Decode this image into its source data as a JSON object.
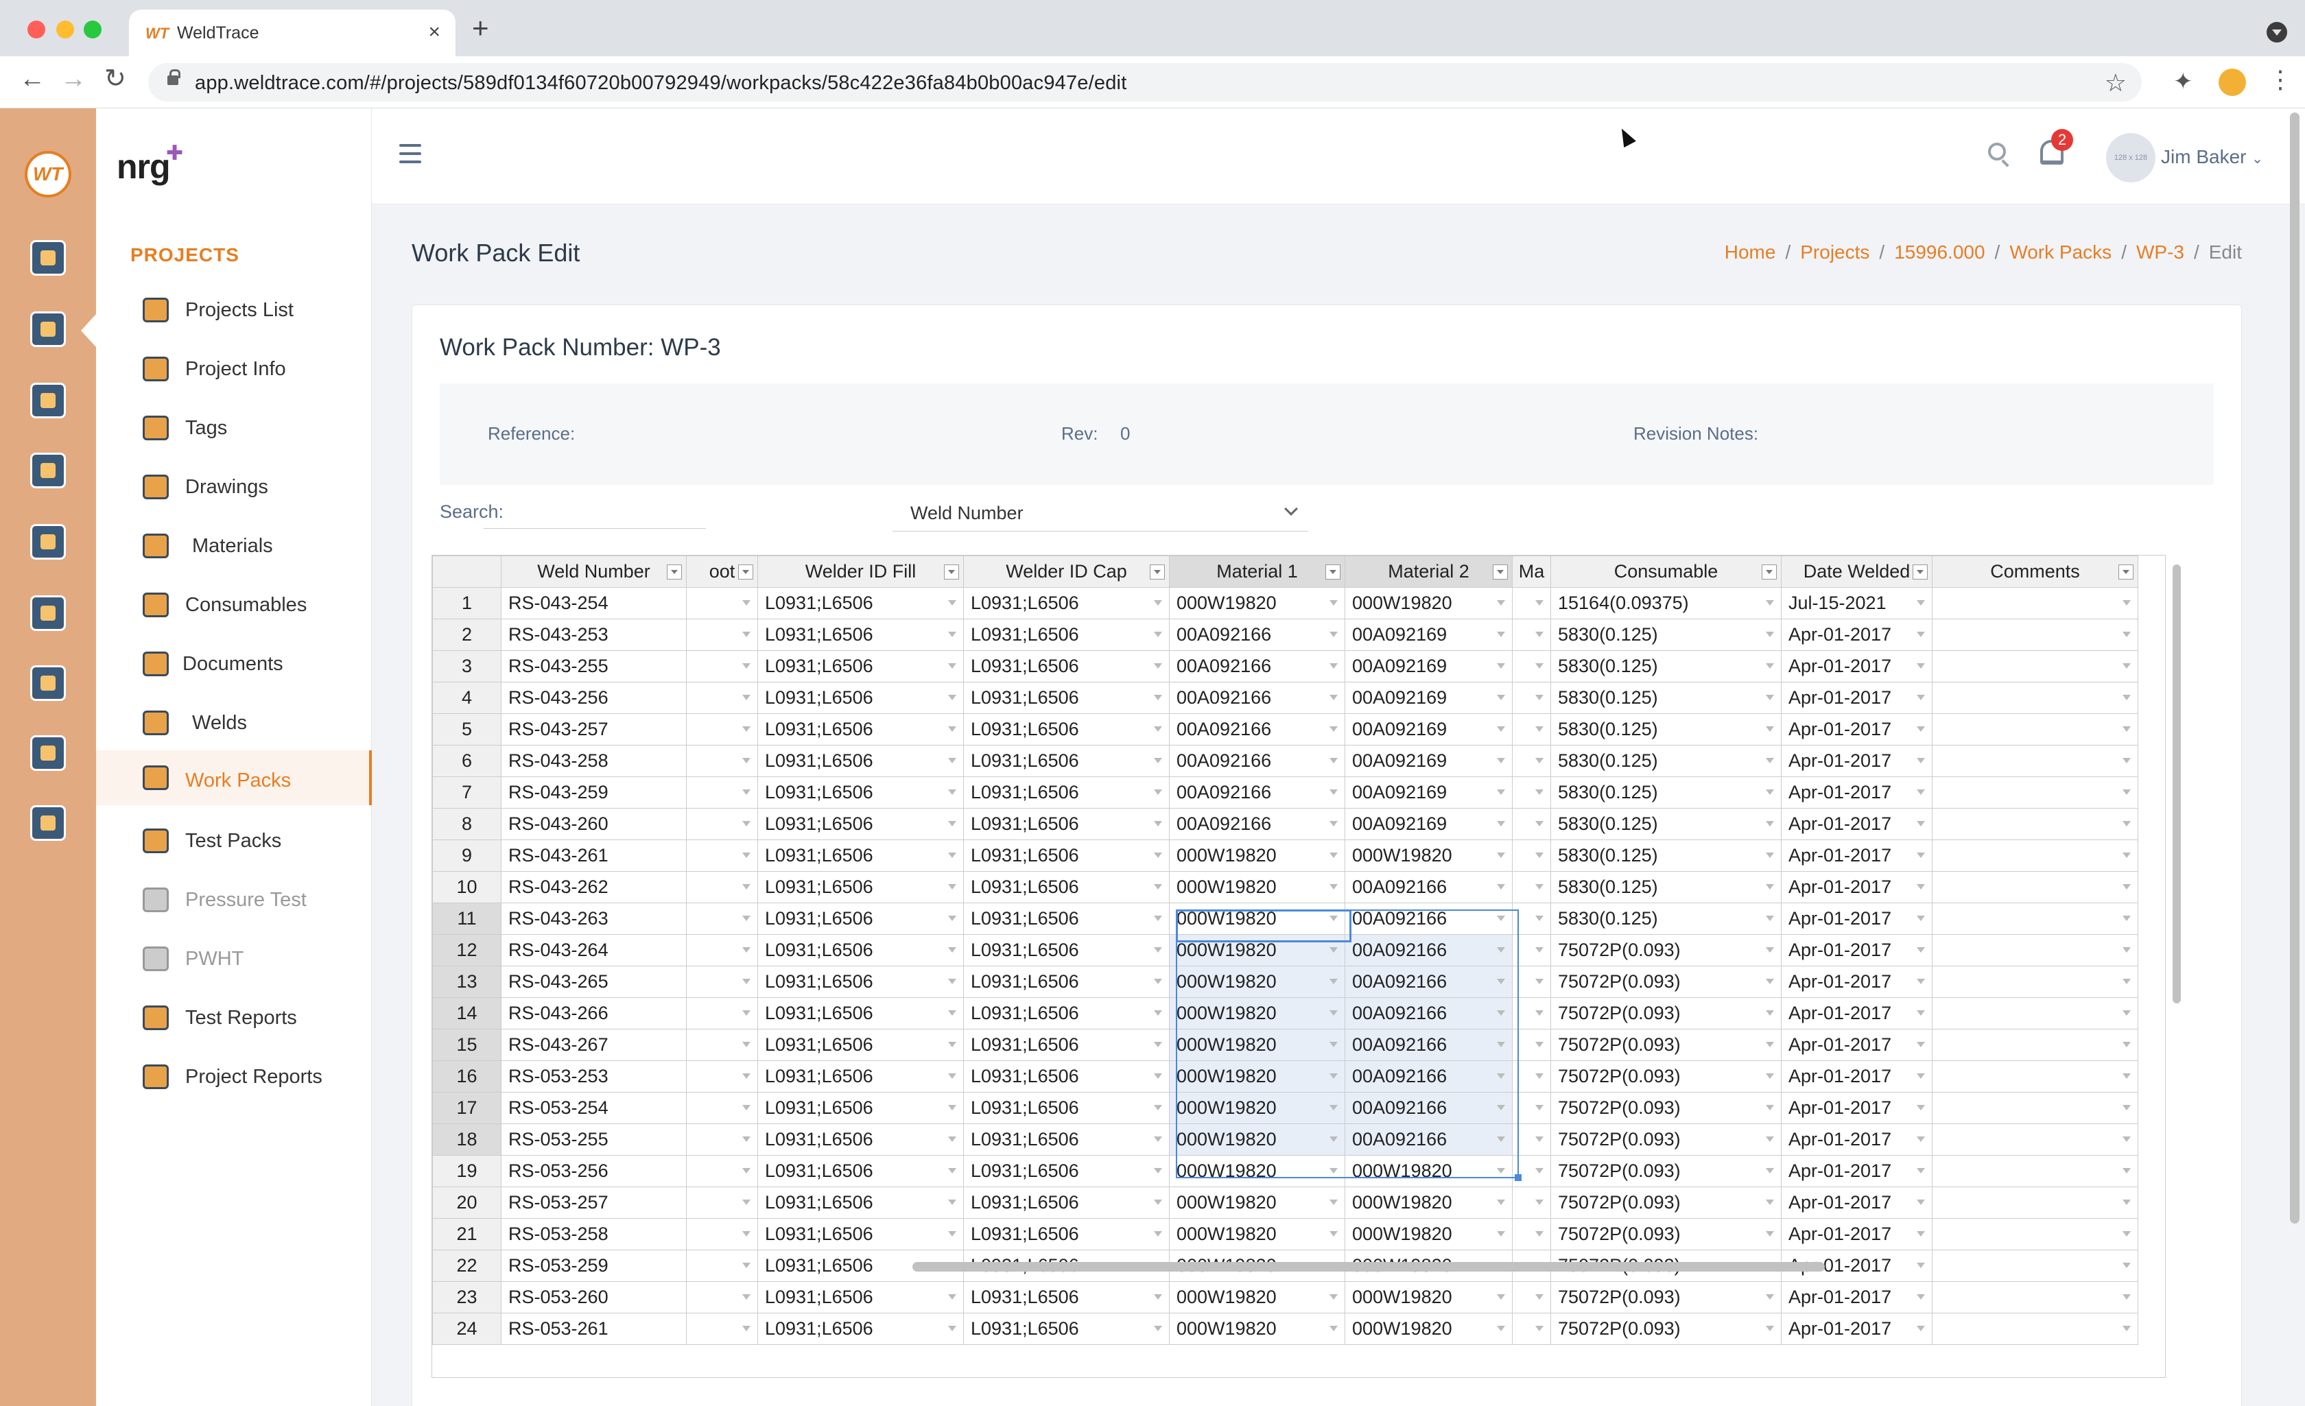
{
  "browser": {
    "tab_favicon": "WT",
    "tab_title": "WeldTrace",
    "url": "app.weldtrace.com/#/projects/589df0134f60720b00792949/workpacks/58c422e36fa84b0b00ac947e/edit"
  },
  "app": {
    "brand": "nrg",
    "rail_logo": "WT",
    "section_title": "PROJECTS",
    "nav": [
      {
        "label": "Projects List",
        "icon": "projects-list-icon"
      },
      {
        "label": "Project Info",
        "icon": "project-info-icon"
      },
      {
        "label": "Tags",
        "icon": "tag-icon"
      },
      {
        "label": "Drawings",
        "icon": "drawings-icon"
      },
      {
        "label": "Materials",
        "icon": "materials-icon"
      },
      {
        "label": "Consumables",
        "icon": "consumables-icon"
      },
      {
        "label": "Documents",
        "icon": "documents-icon"
      },
      {
        "label": "Welds",
        "icon": "welds-icon"
      },
      {
        "label": "Work Packs",
        "icon": "work-packs-icon",
        "active": true
      },
      {
        "label": "Test Packs",
        "icon": "test-packs-icon"
      },
      {
        "label": "Pressure Test",
        "icon": "pressure-test-icon",
        "disabled": true
      },
      {
        "label": "PWHT",
        "icon": "pwht-icon",
        "disabled": true
      },
      {
        "label": "Test Reports",
        "icon": "test-reports-icon"
      },
      {
        "label": "Project Reports",
        "icon": "project-reports-icon"
      }
    ],
    "notifications_count": "2",
    "user_avatar_text": "128 x 128",
    "user_name": "Jim Baker"
  },
  "page": {
    "title": "Work Pack Edit",
    "breadcrumb": [
      "Home",
      "Projects",
      "15996.000",
      "Work Packs",
      "WP-3",
      "Edit"
    ],
    "card_title": "Work Pack Number: WP-3",
    "reference_label": "Reference:",
    "rev_label": "Rev:",
    "rev_value": "0",
    "revision_notes_label": "Revision Notes:",
    "search_label": "Search:",
    "search_field": "Weld Number"
  },
  "grid": {
    "columns": [
      "Weld Number",
      "oot",
      "Welder ID Fill",
      "Welder ID Cap",
      "Material 1",
      "Material 2",
      "Ma",
      "Consumable",
      "Date Welded",
      "Comments"
    ],
    "rows": [
      [
        "1",
        "RS-043-254",
        "",
        "L0931;L6506",
        "L0931;L6506",
        "000W19820",
        "000W19820",
        "",
        "15164(0.09375)",
        "Jul-15-2021",
        ""
      ],
      [
        "2",
        "RS-043-253",
        "",
        "L0931;L6506",
        "L0931;L6506",
        "00A092166",
        "00A092169",
        "",
        "5830(0.125)",
        "Apr-01-2017",
        ""
      ],
      [
        "3",
        "RS-043-255",
        "",
        "L0931;L6506",
        "L0931;L6506",
        "00A092166",
        "00A092169",
        "",
        "5830(0.125)",
        "Apr-01-2017",
        ""
      ],
      [
        "4",
        "RS-043-256",
        "",
        "L0931;L6506",
        "L0931;L6506",
        "00A092166",
        "00A092169",
        "",
        "5830(0.125)",
        "Apr-01-2017",
        ""
      ],
      [
        "5",
        "RS-043-257",
        "",
        "L0931;L6506",
        "L0931;L6506",
        "00A092166",
        "00A092169",
        "",
        "5830(0.125)",
        "Apr-01-2017",
        ""
      ],
      [
        "6",
        "RS-043-258",
        "",
        "L0931;L6506",
        "L0931;L6506",
        "00A092166",
        "00A092169",
        "",
        "5830(0.125)",
        "Apr-01-2017",
        ""
      ],
      [
        "7",
        "RS-043-259",
        "",
        "L0931;L6506",
        "L0931;L6506",
        "00A092166",
        "00A092169",
        "",
        "5830(0.125)",
        "Apr-01-2017",
        ""
      ],
      [
        "8",
        "RS-043-260",
        "",
        "L0931;L6506",
        "L0931;L6506",
        "00A092166",
        "00A092169",
        "",
        "5830(0.125)",
        "Apr-01-2017",
        ""
      ],
      [
        "9",
        "RS-043-261",
        "",
        "L0931;L6506",
        "L0931;L6506",
        "000W19820",
        "000W19820",
        "",
        "5830(0.125)",
        "Apr-01-2017",
        ""
      ],
      [
        "10",
        "RS-043-262",
        "",
        "L0931;L6506",
        "L0931;L6506",
        "000W19820",
        "00A092166",
        "",
        "5830(0.125)",
        "Apr-01-2017",
        ""
      ],
      [
        "11",
        "RS-043-263",
        "",
        "L0931;L6506",
        "L0931;L6506",
        "000W19820",
        "00A092166",
        "",
        "5830(0.125)",
        "Apr-01-2017",
        ""
      ],
      [
        "12",
        "RS-043-264",
        "",
        "L0931;L6506",
        "L0931;L6506",
        "000W19820",
        "00A092166",
        "",
        "75072P(0.093)",
        "Apr-01-2017",
        ""
      ],
      [
        "13",
        "RS-043-265",
        "",
        "L0931;L6506",
        "L0931;L6506",
        "000W19820",
        "00A092166",
        "",
        "75072P(0.093)",
        "Apr-01-2017",
        ""
      ],
      [
        "14",
        "RS-043-266",
        "",
        "L0931;L6506",
        "L0931;L6506",
        "000W19820",
        "00A092166",
        "",
        "75072P(0.093)",
        "Apr-01-2017",
        ""
      ],
      [
        "15",
        "RS-043-267",
        "",
        "L0931;L6506",
        "L0931;L6506",
        "000W19820",
        "00A092166",
        "",
        "75072P(0.093)",
        "Apr-01-2017",
        ""
      ],
      [
        "16",
        "RS-053-253",
        "",
        "L0931;L6506",
        "L0931;L6506",
        "000W19820",
        "00A092166",
        "",
        "75072P(0.093)",
        "Apr-01-2017",
        ""
      ],
      [
        "17",
        "RS-053-254",
        "",
        "L0931;L6506",
        "L0931;L6506",
        "000W19820",
        "00A092166",
        "",
        "75072P(0.093)",
        "Apr-01-2017",
        ""
      ],
      [
        "18",
        "RS-053-255",
        "",
        "L0931;L6506",
        "L0931;L6506",
        "000W19820",
        "00A092166",
        "",
        "75072P(0.093)",
        "Apr-01-2017",
        ""
      ],
      [
        "19",
        "RS-053-256",
        "",
        "L0931;L6506",
        "L0931;L6506",
        "000W19820",
        "000W19820",
        "",
        "75072P(0.093)",
        "Apr-01-2017",
        ""
      ],
      [
        "20",
        "RS-053-257",
        "",
        "L0931;L6506",
        "L0931;L6506",
        "000W19820",
        "000W19820",
        "",
        "75072P(0.093)",
        "Apr-01-2017",
        ""
      ],
      [
        "21",
        "RS-053-258",
        "",
        "L0931;L6506",
        "L0931;L6506",
        "000W19820",
        "000W19820",
        "",
        "75072P(0.093)",
        "Apr-01-2017",
        ""
      ],
      [
        "22",
        "RS-053-259",
        "",
        "L0931;L6506",
        "L0931;L6506",
        "000W19820",
        "000W19820",
        "",
        "75072P(0.093)",
        "Apr-01-2017",
        ""
      ],
      [
        "23",
        "RS-053-260",
        "",
        "L0931;L6506",
        "L0931;L6506",
        "000W19820",
        "000W19820",
        "",
        "75072P(0.093)",
        "Apr-01-2017",
        ""
      ],
      [
        "24",
        "RS-053-261",
        "",
        "L0931;L6506",
        "L0931;L6506",
        "000W19820",
        "000W19820",
        "",
        "75072P(0.093)",
        "Apr-01-2017",
        ""
      ]
    ],
    "selected_rows": [
      "11",
      "12",
      "13",
      "14",
      "15",
      "16",
      "17",
      "18"
    ]
  },
  "colors": {
    "accent": "#e67e22",
    "rail": "#e2aa80",
    "selection": "#4b89dc",
    "badge": "#e53935"
  }
}
